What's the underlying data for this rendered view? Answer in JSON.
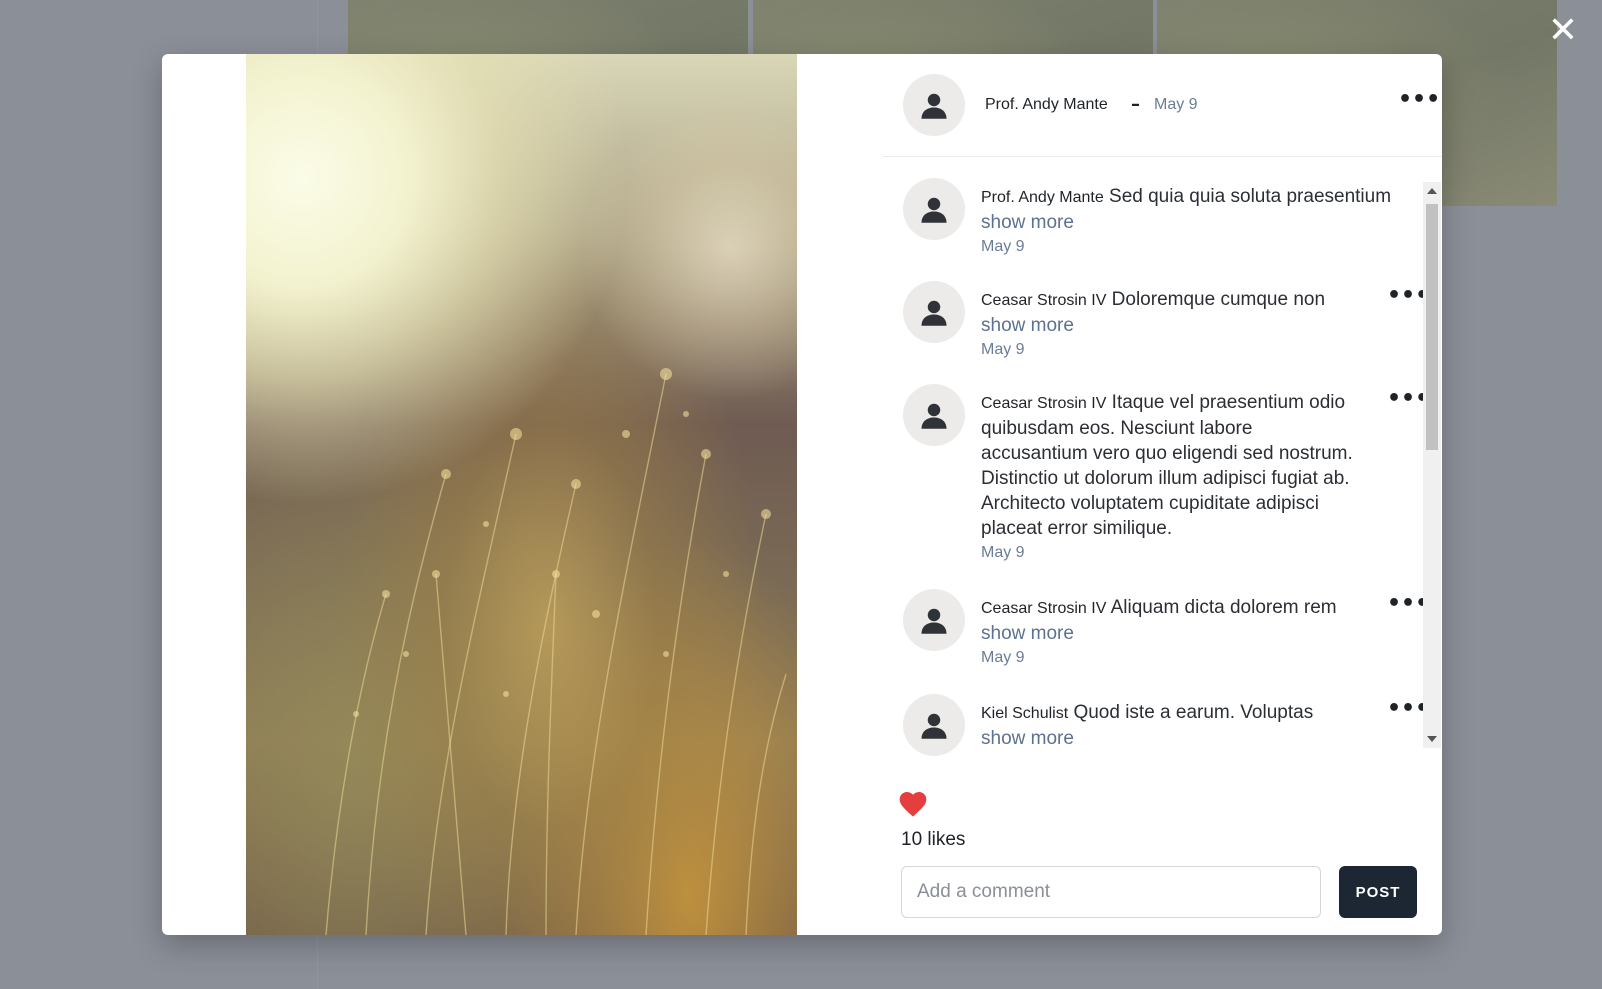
{
  "overlay": {
    "close_symbol": "✕"
  },
  "post": {
    "author": "Prof. Andy Mante",
    "separator": "–",
    "date": "May 9",
    "menu_symbol": "•••",
    "image_icon": "dried-grass-photo"
  },
  "comments": [
    {
      "author": "Prof. Andy Mante",
      "text": "Sed quia quia soluta praesentium",
      "show_more": "show more",
      "date": "May 9",
      "has_menu": false
    },
    {
      "author": "Ceasar Strosin IV",
      "text": "Doloremque cumque non",
      "show_more": "show more",
      "date": "May 9",
      "has_menu": true
    },
    {
      "author": "Ceasar Strosin IV",
      "text": "Itaque vel praesentium odio quibusdam eos. Nesciunt labore accusantium vero quo eligendi sed nostrum. Distinctio ut dolorum illum adipisci fugiat ab. Architecto voluptatem cupiditate adipisci placeat error similique.",
      "show_more": "",
      "date": "May 9",
      "has_menu": true
    },
    {
      "author": "Ceasar Strosin IV",
      "text": "Aliquam dicta dolorem rem",
      "show_more": "show more",
      "date": "May 9",
      "has_menu": true
    },
    {
      "author": "Kiel Schulist",
      "text": "Quod iste a earum. Voluptas",
      "show_more": "show more",
      "date": "",
      "has_menu": true
    }
  ],
  "comment_menu_symbol": "•••",
  "likes": {
    "icon": "heart-icon",
    "liked": true,
    "color": "#e53e3e",
    "label": "10 likes"
  },
  "composer": {
    "placeholder": "Add a comment",
    "post_label": "POST"
  },
  "colors": {
    "post_button": "#1c2733",
    "muted_text": "#6b7d96",
    "link_text": "#5d7190"
  }
}
